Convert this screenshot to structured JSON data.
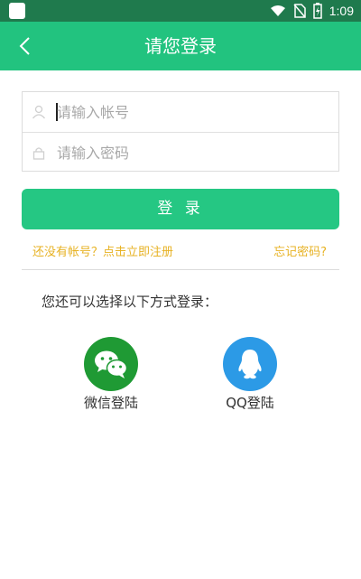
{
  "status_bar": {
    "time": "1:09",
    "icons": [
      "notification-icon",
      "wifi-icon",
      "no-sim-icon",
      "battery-charging-icon"
    ]
  },
  "app_bar": {
    "title": "请您登录",
    "back_icon": "chevron-left-icon"
  },
  "login_form": {
    "account_placeholder": "请输入帐号",
    "account_value": "",
    "password_placeholder": "请输入密码",
    "password_value": "",
    "account_icon": "user-icon",
    "password_icon": "lock-icon"
  },
  "actions": {
    "login_label": "登 录",
    "register_link": "还没有帐号？点击立即注册",
    "forgot_link": "忘记密码?"
  },
  "alternative_login": {
    "hint": "您还可以选择以下方式登录：",
    "options": [
      {
        "label": "微信登陆",
        "icon": "wechat-icon",
        "color": "#1f9a34"
      },
      {
        "label": "QQ登陆",
        "icon": "qq-penguin-icon",
        "color": "#2c9ae6"
      }
    ]
  },
  "colors": {
    "status_bar": "#1f7a4d",
    "primary": "#22c37f",
    "link": "#e7b223"
  }
}
